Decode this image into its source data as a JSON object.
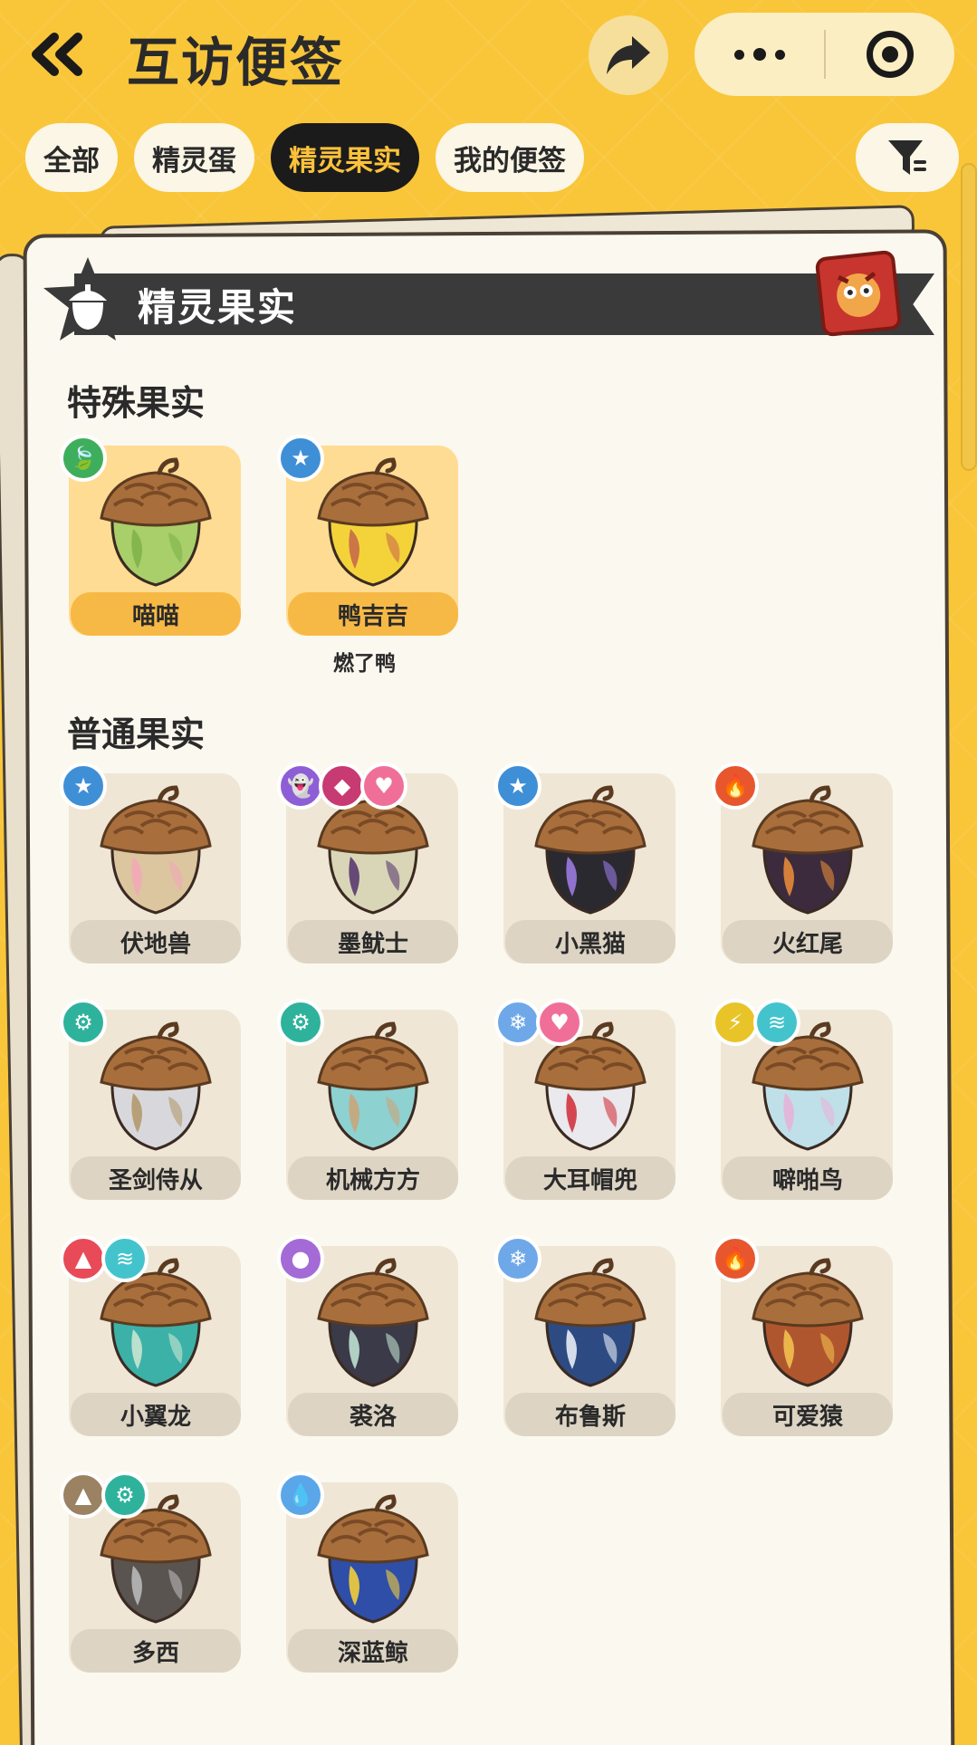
{
  "header": {
    "title": "互访便签",
    "back_icon": "double-chevron-left-icon",
    "share_icon": "share-arrow-icon",
    "more_icon": "more-dots-icon",
    "close_icon": "target-close-icon"
  },
  "tabs": [
    {
      "label": "全部",
      "active": false
    },
    {
      "label": "精灵蛋",
      "active": false
    },
    {
      "label": "精灵果实",
      "active": true
    },
    {
      "label": "我的便签",
      "active": false
    }
  ],
  "filter_icon": "funnel-filter-icon",
  "banner": {
    "title": "精灵果实",
    "icon": "acorn-icon",
    "stamp_icon": "owl-ticket-icon"
  },
  "sections": {
    "special": {
      "title": "特殊果实",
      "items": [
        {
          "name": "喵喵",
          "badges": [
            "leaf"
          ],
          "colors": [
            "#a8cf6a",
            "#7fb24a"
          ],
          "sub": ""
        },
        {
          "name": "鸭吉吉",
          "badges": [
            "star"
          ],
          "colors": [
            "#f4d33a",
            "#c86a48"
          ],
          "sub": "燃了鸭"
        }
      ]
    },
    "normal": {
      "title": "普通果实",
      "items": [
        {
          "name": "伏地兽",
          "badges": [
            "star"
          ],
          "colors": [
            "#dcc6a0",
            "#f2a9b7"
          ]
        },
        {
          "name": "墨鱿士",
          "badges": [
            "ghost",
            "demon",
            "heart"
          ],
          "colors": [
            "#d9d6b8",
            "#5a3a6e"
          ]
        },
        {
          "name": "小黑猫",
          "badges": [
            "star"
          ],
          "colors": [
            "#2a2930",
            "#9a7ae0"
          ]
        },
        {
          "name": "火红尾",
          "badges": [
            "fire"
          ],
          "colors": [
            "#3c2b3c",
            "#e58a3a"
          ]
        },
        {
          "name": "圣剑侍从",
          "badges": [
            "gear"
          ],
          "colors": [
            "#d8d8dc",
            "#b49a6e"
          ]
        },
        {
          "name": "机械方方",
          "badges": [
            "gear"
          ],
          "colors": [
            "#8ed1d1",
            "#c8a57a"
          ]
        },
        {
          "name": "大耳帽兜",
          "badges": [
            "snowflake",
            "heart"
          ],
          "colors": [
            "#e9e9ee",
            "#d2353f"
          ]
        },
        {
          "name": "噼啪鸟",
          "badges": [
            "bolt",
            "wing"
          ],
          "colors": [
            "#bfe0e8",
            "#e6b4d8"
          ]
        },
        {
          "name": "小翼龙",
          "badges": [
            "dragon",
            "wing"
          ],
          "colors": [
            "#3cb1a8",
            "#c9e6d2"
          ]
        },
        {
          "name": "裘洛",
          "badges": [
            "bubble"
          ],
          "colors": [
            "#3a3a48",
            "#bfe0d0"
          ]
        },
        {
          "name": "布鲁斯",
          "badges": [
            "snowflake"
          ],
          "colors": [
            "#2d4b82",
            "#e8edf5"
          ]
        },
        {
          "name": "可爱猿",
          "badges": [
            "fire"
          ],
          "colors": [
            "#b0562e",
            "#f2c050"
          ]
        },
        {
          "name": "多西",
          "badges": [
            "mountain",
            "gear"
          ],
          "colors": [
            "#5a5450",
            "#b8b8b8"
          ]
        },
        {
          "name": "深蓝鲸",
          "badges": [
            "water"
          ],
          "colors": [
            "#2e4ea8",
            "#f3cf3a"
          ]
        }
      ]
    }
  },
  "badge_colors": {
    "leaf": "#3fae5c",
    "star": "#3f8fd6",
    "ghost": "#8e5ed6",
    "demon": "#c83a72",
    "heart": "#f06f98",
    "fire": "#e8562e",
    "gear": "#2fb29c",
    "snowflake": "#6fa8e8",
    "bolt": "#e8c428",
    "wing": "#43c4cc",
    "dragon": "#e84a58",
    "bubble": "#a46ad6",
    "mountain": "#9a8262",
    "water": "#5aa6e8"
  }
}
